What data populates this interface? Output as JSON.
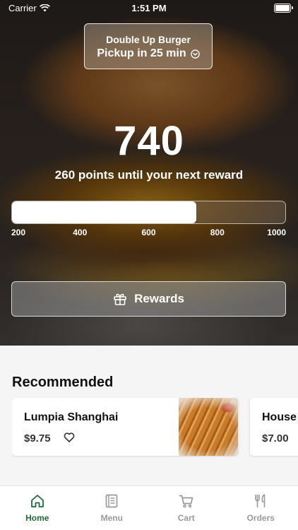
{
  "status_bar": {
    "carrier": "Carrier",
    "time": "1:51 PM",
    "battery_icon": "battery-full-icon",
    "wifi_icon": "wifi-icon"
  },
  "location": {
    "store_name": "Double Up Burger",
    "pickup": "Pickup in 25 min",
    "icon": "chevron-down-circle-icon"
  },
  "rewards": {
    "points": "740",
    "message": "260 points until your next reward",
    "progress": {
      "min": 200,
      "max": 1000,
      "value": 740,
      "ticks": [
        "200",
        "400",
        "600",
        "800",
        "1000"
      ]
    },
    "button_label": "Rewards",
    "button_icon": "gift-icon"
  },
  "recommended": {
    "title": "Recommended",
    "items": [
      {
        "name": "Lumpia Shanghai",
        "price": "$9.75",
        "favorite_icon": "heart-outline-icon"
      },
      {
        "name": "House",
        "price": "$7.00"
      }
    ]
  },
  "tabs": [
    {
      "label": "Home",
      "icon": "home-icon",
      "active": true
    },
    {
      "label": "Menu",
      "icon": "menu-book-icon",
      "active": false
    },
    {
      "label": "Cart",
      "icon": "cart-icon",
      "active": false
    },
    {
      "label": "Orders",
      "icon": "utensils-icon",
      "active": false
    }
  ],
  "colors": {
    "accent": "#1f6b3a",
    "inactive_tab": "#9a9a9a"
  }
}
